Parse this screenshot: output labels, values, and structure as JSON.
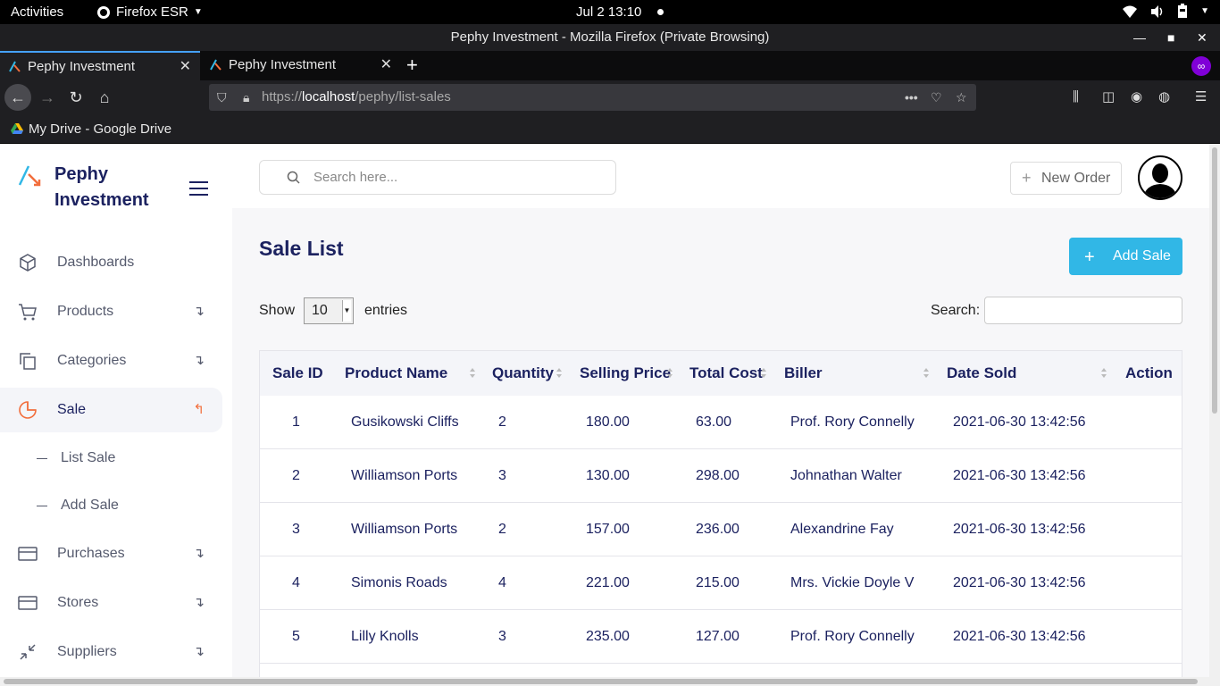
{
  "system": {
    "activities": "Activities",
    "app_name": "Firefox ESR",
    "clock": "Jul 2  13:10"
  },
  "window": {
    "title": "Pephy Investment - Mozilla Firefox (Private Browsing)"
  },
  "tabs": [
    {
      "label": "Pephy Investment",
      "active": true
    },
    {
      "label": "Pephy Investment",
      "active": false
    }
  ],
  "url": {
    "prefix": "https://",
    "host": "localhost",
    "path": "/pephy/list-sales"
  },
  "bookmarks": [
    {
      "label": "My Drive - Google Drive"
    }
  ],
  "sidebar": {
    "brand_line1": "Pephy",
    "brand_line2": "Investment",
    "items": [
      {
        "label": "Dashboards",
        "icon": "cube-icon",
        "has_arrow": false
      },
      {
        "label": "Products",
        "icon": "cart-icon",
        "has_arrow": true
      },
      {
        "label": "Categories",
        "icon": "copy-icon",
        "has_arrow": true
      },
      {
        "label": "Sale",
        "icon": "pie-chart-icon",
        "has_arrow": true,
        "active": true
      },
      {
        "label": "Purchases",
        "icon": "credit-card-icon",
        "has_arrow": true
      },
      {
        "label": "Stores",
        "icon": "credit-card-icon",
        "has_arrow": true
      },
      {
        "label": "Suppliers",
        "icon": "minimize-icon",
        "has_arrow": true
      }
    ],
    "submenu": [
      {
        "label": "List Sale"
      },
      {
        "label": "Add Sale"
      }
    ],
    "arrow_down": "↴",
    "arrow_up": "↰"
  },
  "header": {
    "search_placeholder": "Search here...",
    "new_order_label": "New Order"
  },
  "main": {
    "title": "Sale List",
    "add_sale_label": "Add Sale",
    "show_label": "Show",
    "entries_value": "10",
    "entries_label": "entries",
    "search_label": "Search:",
    "columns": [
      "Sale ID",
      "Product Name",
      "Quantity",
      "Selling Price",
      "Total Cost",
      "Biller",
      "Date Sold",
      "Action"
    ],
    "rows": [
      [
        "1",
        "Gusikowski Cliffs",
        "2",
        "180.00",
        "63.00",
        "Prof. Rory Connelly",
        "2021-06-30 13:42:56",
        ""
      ],
      [
        "2",
        "Williamson Ports",
        "3",
        "130.00",
        "298.00",
        "Johnathan Walter",
        "2021-06-30 13:42:56",
        ""
      ],
      [
        "3",
        "Williamson Ports",
        "2",
        "157.00",
        "236.00",
        "Alexandrine Fay",
        "2021-06-30 13:42:56",
        ""
      ],
      [
        "4",
        "Simonis Roads",
        "4",
        "221.00",
        "215.00",
        "Mrs. Vickie Doyle V",
        "2021-06-30 13:42:56",
        ""
      ],
      [
        "5",
        "Lilly Knolls",
        "3",
        "235.00",
        "127.00",
        "Prof. Rory Connelly",
        "2021-06-30 13:42:56",
        ""
      ]
    ]
  },
  "colors": {
    "brand": "#1c2260",
    "accent": "#31b7e6",
    "active_arrow": "#f26e3c"
  }
}
